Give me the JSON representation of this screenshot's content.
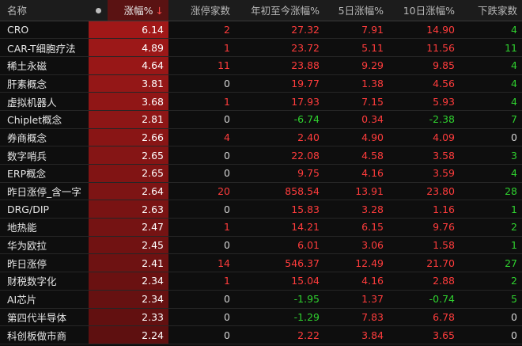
{
  "colors": {
    "red": "#ff3c3c",
    "green": "#2fd12f",
    "pct_bar_top": "#a01818",
    "pct_bar_bottom": "#5e1010"
  },
  "header": {
    "name": "名称",
    "pct": "涨幅%",
    "sort_arrow": "↓",
    "limit_up": "涨停家数",
    "ytd": "年初至今涨幅%",
    "d5": "5日涨幅%",
    "d10": "10日涨幅%",
    "down": "下跌家数"
  },
  "rows": [
    {
      "name": "CRO",
      "pct": "6.14",
      "limit_up": "2",
      "ytd": "27.32",
      "d5": "7.91",
      "d10": "14.90",
      "down": "4"
    },
    {
      "name": "CAR-T细胞疗法",
      "pct": "4.89",
      "limit_up": "1",
      "ytd": "23.72",
      "d5": "5.11",
      "d10": "11.56",
      "down": "11"
    },
    {
      "name": "稀土永磁",
      "pct": "4.64",
      "limit_up": "11",
      "ytd": "23.88",
      "d5": "9.29",
      "d10": "9.85",
      "down": "4"
    },
    {
      "name": "肝素概念",
      "pct": "3.81",
      "limit_up": "0",
      "ytd": "19.77",
      "d5": "1.38",
      "d10": "4.56",
      "down": "4"
    },
    {
      "name": "虚拟机器人",
      "pct": "3.68",
      "limit_up": "1",
      "ytd": "17.93",
      "d5": "7.15",
      "d10": "5.93",
      "down": "4"
    },
    {
      "name": "Chiplet概念",
      "pct": "2.81",
      "limit_up": "0",
      "ytd": "-6.74",
      "d5": "0.34",
      "d10": "-2.38",
      "down": "7"
    },
    {
      "name": "券商概念",
      "pct": "2.66",
      "limit_up": "4",
      "ytd": "2.40",
      "d5": "4.90",
      "d10": "4.09",
      "down": "0"
    },
    {
      "name": "数字哨兵",
      "pct": "2.65",
      "limit_up": "0",
      "ytd": "22.08",
      "d5": "4.58",
      "d10": "3.58",
      "down": "3"
    },
    {
      "name": "ERP概念",
      "pct": "2.65",
      "limit_up": "0",
      "ytd": "9.75",
      "d5": "4.16",
      "d10": "3.59",
      "down": "4"
    },
    {
      "name": "昨日涨停_含一字",
      "pct": "2.64",
      "limit_up": "20",
      "ytd": "858.54",
      "d5": "13.91",
      "d10": "23.80",
      "down": "28"
    },
    {
      "name": "DRG/DIP",
      "pct": "2.63",
      "limit_up": "0",
      "ytd": "15.83",
      "d5": "3.28",
      "d10": "1.16",
      "down": "1"
    },
    {
      "name": "地热能",
      "pct": "2.47",
      "limit_up": "1",
      "ytd": "14.21",
      "d5": "6.15",
      "d10": "9.76",
      "down": "2"
    },
    {
      "name": "华为欧拉",
      "pct": "2.45",
      "limit_up": "0",
      "ytd": "6.01",
      "d5": "3.06",
      "d10": "1.58",
      "down": "1"
    },
    {
      "name": "昨日涨停",
      "pct": "2.41",
      "limit_up": "14",
      "ytd": "546.37",
      "d5": "12.49",
      "d10": "21.70",
      "down": "27"
    },
    {
      "name": "财税数字化",
      "pct": "2.34",
      "limit_up": "1",
      "ytd": "15.04",
      "d5": "4.16",
      "d10": "2.88",
      "down": "2"
    },
    {
      "name": "AI芯片",
      "pct": "2.34",
      "limit_up": "0",
      "ytd": "-1.95",
      "d5": "1.37",
      "d10": "-0.74",
      "down": "5"
    },
    {
      "name": "第四代半导体",
      "pct": "2.33",
      "limit_up": "0",
      "ytd": "-1.29",
      "d5": "7.83",
      "d10": "6.78",
      "down": "0"
    },
    {
      "name": "科创板做市商",
      "pct": "2.24",
      "limit_up": "0",
      "ytd": "2.22",
      "d5": "3.84",
      "d10": "3.65",
      "down": "0"
    }
  ]
}
